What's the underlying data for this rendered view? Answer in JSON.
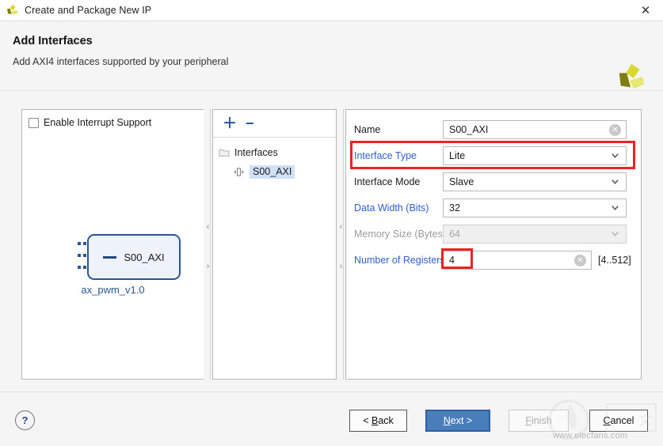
{
  "window": {
    "title": "Create and Package New IP",
    "app_icon": "vivado-logo-icon",
    "close_label": "✕"
  },
  "header": {
    "title": "Add Interfaces",
    "subtitle": "Add AXI4 interfaces supported by your peripheral",
    "logo_icon": "xilinx-logo-icon"
  },
  "left_panel": {
    "interrupt_checkbox": {
      "label": "Enable Interrupt Support",
      "checked": false
    },
    "diagram": {
      "port_label": "S00_AXI",
      "module_name": "ax_pwm_v1.0"
    }
  },
  "middle_panel": {
    "toolbar": {
      "add_label": "＋",
      "remove_label": "−"
    },
    "tree": {
      "root_label": "Interfaces",
      "root_icon": "folder-icon",
      "child_label": "S00_AXI",
      "child_icon": "bus-interface-icon",
      "child_selected": true
    }
  },
  "right_panel": {
    "fields": [
      {
        "label": "Name",
        "value": "S00_AXI",
        "type": "text",
        "label_color": "black",
        "disabled": false,
        "clear_icon": "clear-circle-icon",
        "hint": ""
      },
      {
        "label": "Interface Type",
        "value": "Lite",
        "type": "select",
        "label_color": "blue",
        "disabled": false,
        "chevron_icon": "chevron-down-icon",
        "hint": ""
      },
      {
        "label": "Interface Mode",
        "value": "Slave",
        "type": "select",
        "label_color": "black",
        "disabled": false,
        "chevron_icon": "chevron-down-icon",
        "hint": ""
      },
      {
        "label": "Data Width (Bits)",
        "value": "32",
        "type": "select",
        "label_color": "blue",
        "disabled": false,
        "chevron_icon": "chevron-down-icon",
        "hint": ""
      },
      {
        "label": "Memory Size (Bytes)",
        "value": "64",
        "type": "select",
        "label_color": "muted",
        "disabled": true,
        "chevron_icon": "chevron-down-icon",
        "hint": ""
      },
      {
        "label": "Number of Registers",
        "value": "4",
        "type": "text",
        "label_color": "blue",
        "disabled": false,
        "clear_icon": "clear-circle-icon",
        "hint": "[4..512]"
      }
    ]
  },
  "annotations": {
    "color": "#ee2222",
    "boxes": [
      "interface-type-row",
      "number-of-registers-value"
    ]
  },
  "splitters": {
    "collapse_left_icon": "‹",
    "collapse_right_icon": "›"
  },
  "footer": {
    "help_label": "?",
    "buttons": [
      {
        "name": "back",
        "prefix": "< ",
        "accel": "B",
        "suffix": "ack",
        "disabled": false,
        "primary": false
      },
      {
        "name": "next",
        "prefix": "",
        "accel": "N",
        "suffix": "ext >",
        "disabled": false,
        "primary": true
      },
      {
        "name": "finish",
        "prefix": "",
        "accel": "F",
        "suffix": "inish",
        "disabled": true,
        "primary": false
      },
      {
        "name": "cancel",
        "prefix": "",
        "accel": "C",
        "suffix": "ancel",
        "disabled": false,
        "primary": false
      }
    ]
  },
  "watermark": {
    "text": "www.elecfans.com"
  }
}
